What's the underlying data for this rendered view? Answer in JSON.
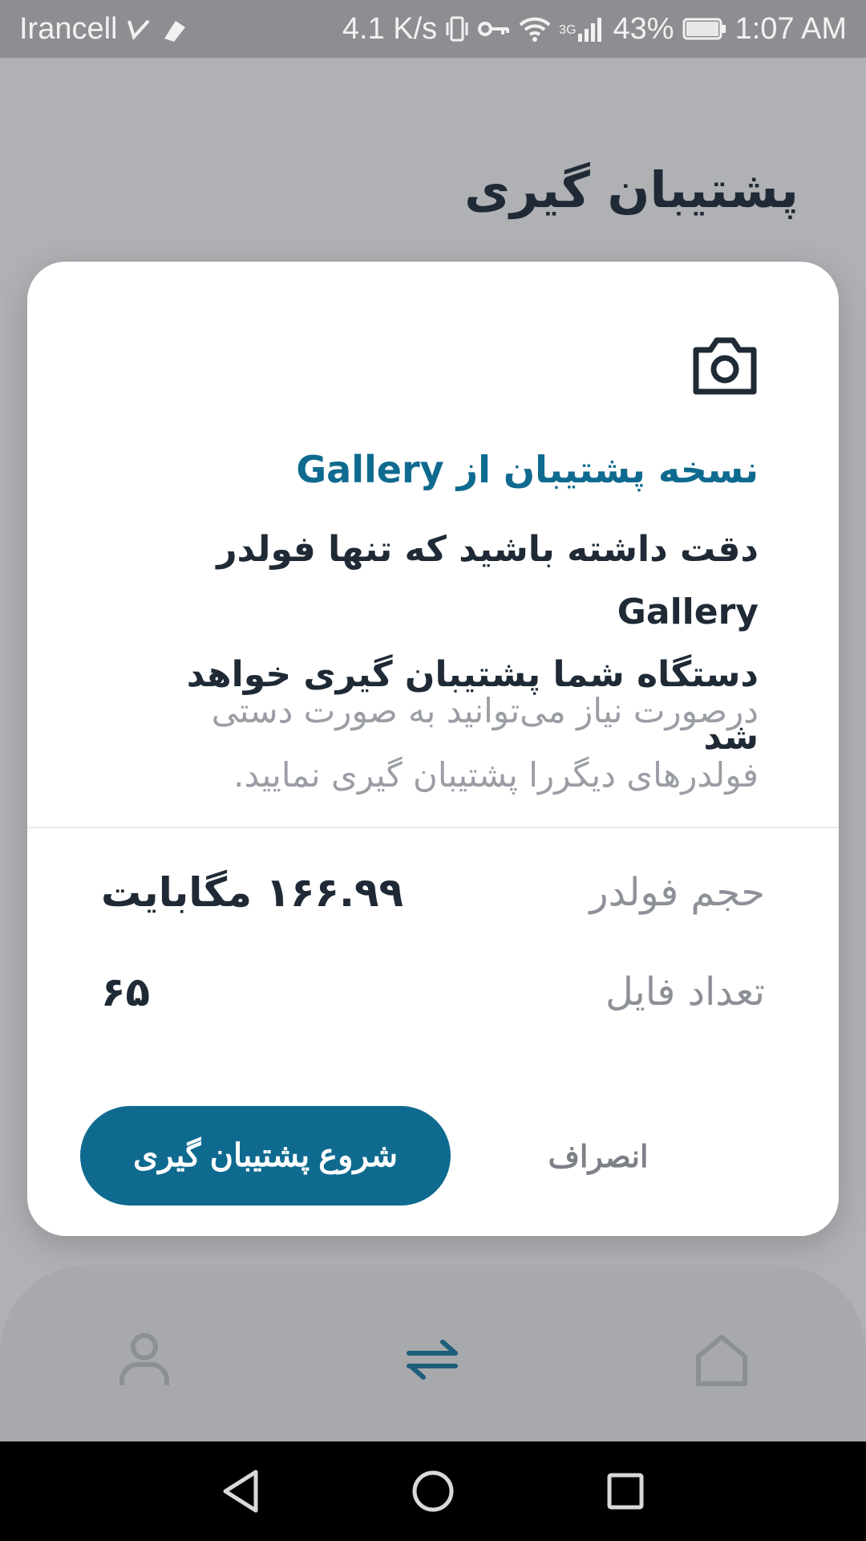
{
  "status_bar": {
    "carrier": "Irancell",
    "speed": "4.1 K/s",
    "network": "3G",
    "battery": "43%",
    "time": "1:07 AM"
  },
  "page": {
    "title": "پشتیبان گیری"
  },
  "dialog": {
    "icon": "camera-icon",
    "title": "نسخه پشتیبان از Gallery",
    "warning_line1": "دقت داشته باشید که تنها فولدر Gallery",
    "warning_line2": "دستگاه شما پشتیبان گیری خواهد شد",
    "note_line1": "درصورت نیاز می‌توانید به صورت دستی",
    "note_line2": "فولدرهای دیگررا پشتیبان گیری نمایید.",
    "size_label": "حجم فولدر",
    "size_value": "۱۶۶.۹۹ مگابایت",
    "count_label": "تعداد فایل",
    "count_value": "۶۵",
    "cancel_label": "انصراف",
    "start_label": "شروع پشتیبان گیری"
  },
  "bottom_nav": {
    "items": [
      "profile-icon",
      "transfer-icon",
      "home-icon"
    ],
    "active": "transfer-icon"
  },
  "colors": {
    "accent": "#0f6a8f",
    "text_dark": "#1f2a36",
    "text_muted": "#8d9197",
    "overlay_bg": "#b0b1b4"
  }
}
